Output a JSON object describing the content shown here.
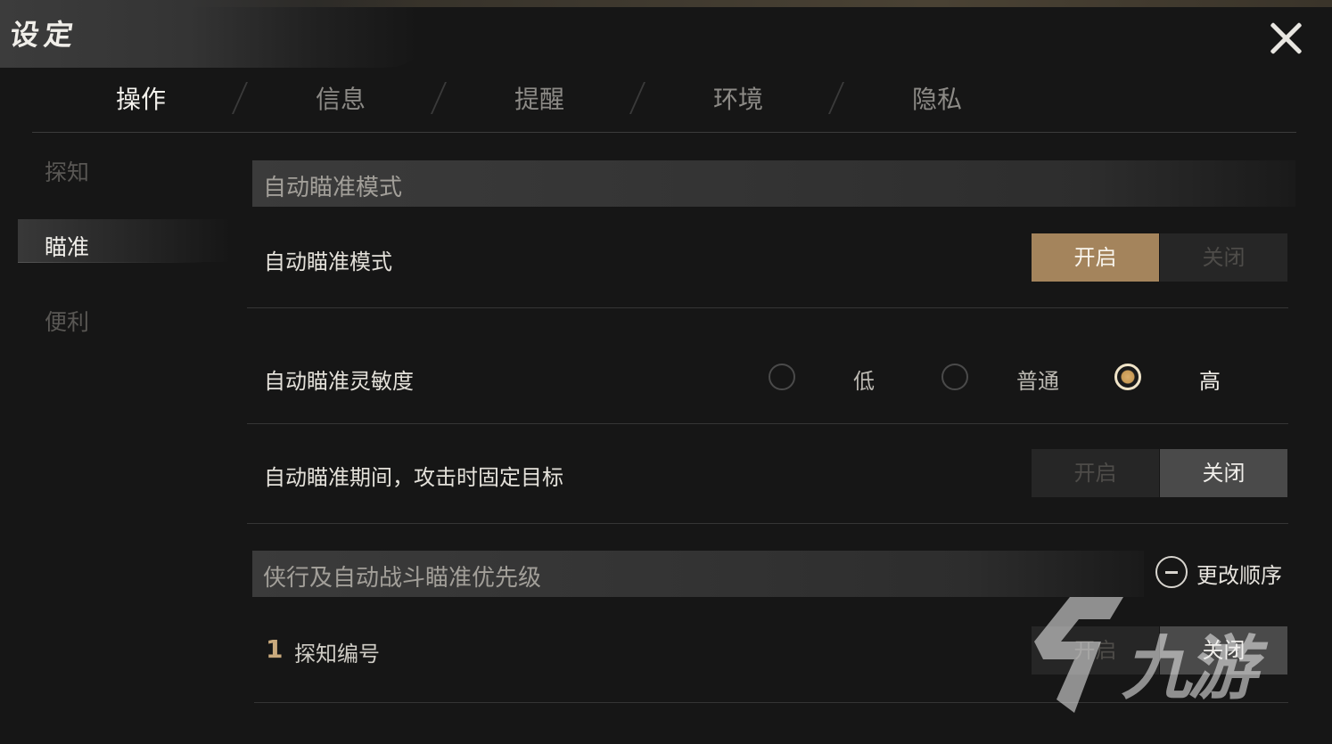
{
  "window": {
    "title": "设定",
    "close_icon": "close-icon"
  },
  "tabs": [
    {
      "label": "操作",
      "active": true
    },
    {
      "label": "信息",
      "active": false
    },
    {
      "label": "提醒",
      "active": false
    },
    {
      "label": "环境",
      "active": false
    },
    {
      "label": "隐私",
      "active": false
    }
  ],
  "sidebar": [
    {
      "label": "探知",
      "active": false
    },
    {
      "label": "瞄准",
      "active": true
    },
    {
      "label": "便利",
      "active": false
    }
  ],
  "sections": {
    "auto_aim": {
      "title": "自动瞄准模式",
      "mode": {
        "label": "自动瞄准模式",
        "on": "开启",
        "off": "关闭",
        "value": "开启"
      },
      "sensitivity": {
        "label": "自动瞄准灵敏度",
        "options": [
          "低",
          "普通",
          "高"
        ],
        "value": "高"
      },
      "lock_target": {
        "label": "自动瞄准期间，攻击时固定目标",
        "on": "开启",
        "off": "关闭",
        "value": "关闭"
      }
    },
    "priority": {
      "title": "侠行及自动战斗瞄准优先级",
      "change_order": "更改顺序",
      "items": [
        {
          "rank": "1",
          "label": "探知编号",
          "on": "开启",
          "off": "关闭"
        }
      ]
    }
  },
  "watermark": {
    "text": "九游"
  },
  "colors": {
    "accent_gold": "#a4845c",
    "toggle_gray": "#4a4a4a",
    "background": "#161616"
  }
}
